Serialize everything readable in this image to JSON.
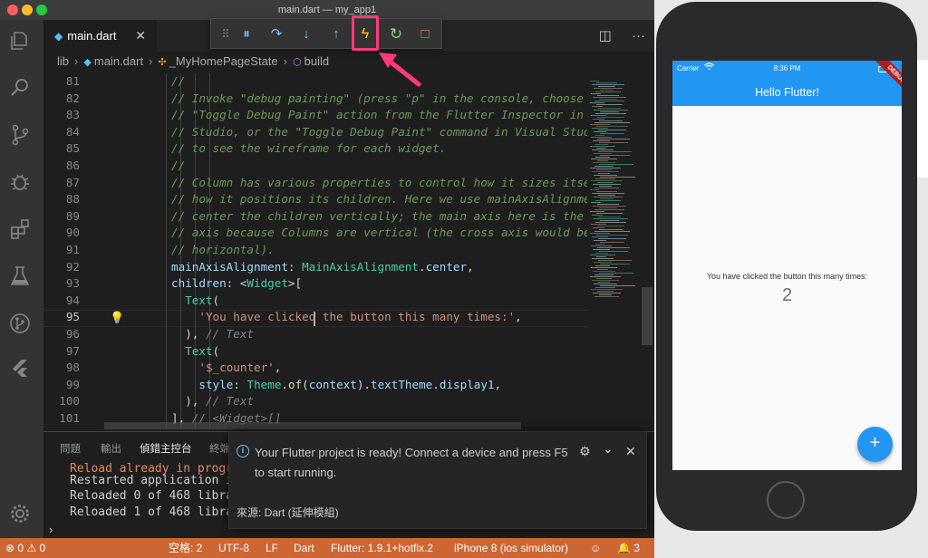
{
  "window": {
    "title": "main.dart — my_app1"
  },
  "tab": {
    "label": "main.dart",
    "close": "✕"
  },
  "editor_actions": {
    "split": "◫",
    "more": "···"
  },
  "breadcrumbs": [
    "lib",
    "main.dart",
    "_MyHomePageState",
    "build"
  ],
  "debug_toolbar": {
    "grip": "⠿",
    "pause": "⏸",
    "step_over": "↷",
    "step_into": "↓",
    "step_out": "↑",
    "hot_reload": "ϟ",
    "restart": "↻",
    "stop": "□"
  },
  "code": [
    {
      "n": "81",
      "parts": [
        [
          "cm",
          "//"
        ]
      ],
      "indent": 0
    },
    {
      "n": "82",
      "parts": [
        [
          "cm",
          "// Invoke \"debug painting\" (press \"p\" in the console, choose"
        ]
      ],
      "indent": 0
    },
    {
      "n": "83",
      "parts": [
        [
          "cm",
          "// \"Toggle Debug Paint\" action from the Flutter Inspector in A"
        ]
      ],
      "indent": 0
    },
    {
      "n": "84",
      "parts": [
        [
          "cm",
          "// Studio, or the \"Toggle Debug Paint\" command in Visual Studi"
        ]
      ],
      "indent": 0
    },
    {
      "n": "85",
      "parts": [
        [
          "cm",
          "// to see the wireframe for each widget."
        ]
      ],
      "indent": 0
    },
    {
      "n": "86",
      "parts": [
        [
          "cm",
          "//"
        ]
      ],
      "indent": 0
    },
    {
      "n": "87",
      "parts": [
        [
          "cm",
          "// Column has various properties to control how it sizes itse"
        ]
      ],
      "indent": 0
    },
    {
      "n": "88",
      "parts": [
        [
          "cm",
          "// how it positions its children. Here we use mainAxisAlignme"
        ]
      ],
      "indent": 0
    },
    {
      "n": "89",
      "parts": [
        [
          "cm",
          "// center the children vertically; the main axis here is the v"
        ]
      ],
      "indent": 0
    },
    {
      "n": "90",
      "parts": [
        [
          "cm",
          "// axis because Columns are vertical (the cross axis would be"
        ]
      ],
      "indent": 0
    },
    {
      "n": "91",
      "parts": [
        [
          "cm",
          "// horizontal)."
        ]
      ],
      "indent": 0
    },
    {
      "n": "92",
      "parts": [
        [
          "prop",
          "mainAxisAlignment"
        ],
        [
          "punc",
          ": "
        ],
        [
          "cls",
          "MainAxisAlignment"
        ],
        [
          "punc",
          "."
        ],
        [
          "prop",
          "center"
        ],
        [
          "punc",
          ","
        ]
      ],
      "indent": 0
    },
    {
      "n": "93",
      "parts": [
        [
          "prop",
          "children"
        ],
        [
          "punc",
          ": <"
        ],
        [
          "cls",
          "Widget"
        ],
        [
          "punc",
          ">["
        ]
      ],
      "indent": 0
    },
    {
      "n": "94",
      "parts": [
        [
          "cls",
          "Text"
        ],
        [
          "punc",
          "("
        ]
      ],
      "indent": 1
    },
    {
      "n": "95",
      "parts": [
        [
          "str",
          "'You have clicked the button this many times:'"
        ],
        [
          "punc",
          ","
        ]
      ],
      "indent": 2
    },
    {
      "n": "96",
      "parts": [
        [
          "punc",
          "), "
        ],
        [
          "gray",
          "// Text"
        ]
      ],
      "indent": 1
    },
    {
      "n": "97",
      "parts": [
        [
          "cls",
          "Text"
        ],
        [
          "punc",
          "("
        ]
      ],
      "indent": 1
    },
    {
      "n": "98",
      "parts": [
        [
          "str",
          "'$_counter'"
        ],
        [
          "punc",
          ","
        ]
      ],
      "indent": 2
    },
    {
      "n": "99",
      "parts": [
        [
          "prop",
          "style"
        ],
        [
          "punc",
          ": "
        ],
        [
          "cls",
          "Theme"
        ],
        [
          "punc",
          "."
        ],
        [
          "fn",
          "of"
        ],
        [
          "punc",
          "("
        ],
        [
          "prop",
          "context"
        ],
        [
          "punc",
          ")."
        ],
        [
          "prop",
          "textTheme"
        ],
        [
          "punc",
          "."
        ],
        [
          "prop",
          "display1"
        ],
        [
          "punc",
          ","
        ]
      ],
      "indent": 2
    },
    {
      "n": "100",
      "parts": [
        [
          "punc",
          "), "
        ],
        [
          "gray",
          "// Text"
        ]
      ],
      "indent": 1
    },
    {
      "n": "101",
      "parts": [
        [
          "punc",
          "], "
        ],
        [
          "gray",
          "// <Widget>[]"
        ]
      ],
      "indent": 0
    }
  ],
  "panel": {
    "tabs": [
      "問題",
      "輸出",
      "偵錯主控台",
      "終端"
    ],
    "lines": [
      "Reload already in progr",
      "Restarted application i",
      "Reloaded 0 of 468 libra",
      "Reloaded 1 of 468 libra"
    ],
    "prompt": "›"
  },
  "notification": {
    "message": "Your Flutter project is ready! Connect a device and press F5 to start running.",
    "source": "來源: Dart (延伸模組)",
    "gear": "⚙",
    "chevron": "⌄",
    "close": "✕"
  },
  "statusbar": {
    "errors": "0",
    "warnings": "0",
    "spaces": "空格: 2",
    "encoding": "UTF-8",
    "eol": "LF",
    "language": "Dart",
    "flutter": "Flutter: 1.9.1+hotfix.2",
    "device": "iPhone 8 (ios simulator)",
    "notifications": "3"
  },
  "simulator": {
    "carrier": "Carrier",
    "time": "8:36 PM",
    "appbar_title": "Hello Flutter!",
    "debug_banner": "DEBUG",
    "counter_label": "You have clicked the button this many times:",
    "counter_value": "2",
    "fab": "+"
  },
  "colors": {
    "accent_highlight": "#ff3a7a",
    "statusbar": "#cc6633",
    "flutter_blue": "#2196f3"
  }
}
